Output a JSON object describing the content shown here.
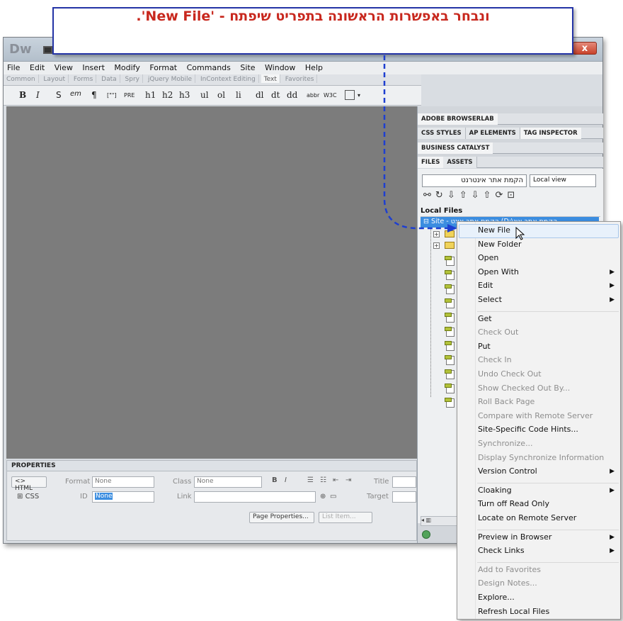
{
  "callout": {
    "text": "ונבחר באפשרות הראשונה בתפריט שיפתח - 'New File'."
  },
  "window": {
    "logo": "Dw",
    "close_label": "x"
  },
  "menubar": [
    "File",
    "Edit",
    "View",
    "Insert",
    "Modify",
    "Format",
    "Commands",
    "Site",
    "Window",
    "Help"
  ],
  "insert_tabs": [
    "Common",
    "Layout",
    "Forms",
    "Data",
    "Spry",
    "jQuery Mobile",
    "InContext Editing",
    "Text",
    "Favorites"
  ],
  "insert_active_tab": "Text",
  "text_toolbar": [
    "B",
    "I",
    "S",
    "em",
    "¶",
    "[\"\"]",
    "PRE",
    "h1",
    "h2",
    "h3",
    "ul",
    "ol",
    "li",
    "dl",
    "dt",
    "dd",
    "abbr",
    "W3C"
  ],
  "properties": {
    "title": "PROPERTIES",
    "html_label": "HTML",
    "css_label": "CSS",
    "format_label": "Format",
    "format_value": "None",
    "id_label": "ID",
    "id_value": "None",
    "class_label": "Class",
    "class_value": "None",
    "link_label": "Link",
    "title_label": "Title",
    "target_label": "Target",
    "page_properties": "Page Properties...",
    "list_item": "List Item..."
  },
  "panels": {
    "browserlab": "ADOBE BROWSERLAB",
    "tabs_row1": [
      "CSS STYLES",
      "AP ELEMENTS",
      "TAG INSPECTOR"
    ],
    "business_catalyst": "BUSINESS CATALYST",
    "tabs_row2": [
      "FILES",
      "ASSETS"
    ],
    "site_select": "הקמת אתר אינטרנט",
    "view_select": "Local view",
    "local_files_label": "Local Files",
    "site_root": "Site - הקמת אתר אינט (D:\\הקמת אתר אינ"
  },
  "context_menu": [
    {
      "label": "New File",
      "enabled": true,
      "highlighted": true
    },
    {
      "label": "New Folder",
      "enabled": true
    },
    {
      "label": "Open",
      "enabled": true
    },
    {
      "label": "Open With",
      "enabled": true,
      "submenu": true
    },
    {
      "label": "Edit",
      "enabled": true,
      "submenu": true
    },
    {
      "label": "Select",
      "enabled": true,
      "submenu": true
    },
    {
      "separator": true
    },
    {
      "label": "Get",
      "enabled": true
    },
    {
      "label": "Check Out",
      "enabled": false
    },
    {
      "label": "Put",
      "enabled": true
    },
    {
      "label": "Check In",
      "enabled": false
    },
    {
      "label": "Undo Check Out",
      "enabled": false
    },
    {
      "label": "Show Checked Out By...",
      "enabled": false
    },
    {
      "label": "Roll Back Page",
      "enabled": false
    },
    {
      "label": "Compare with Remote Server",
      "enabled": false
    },
    {
      "label": "Site-Specific Code Hints...",
      "enabled": true
    },
    {
      "label": "Synchronize...",
      "enabled": false
    },
    {
      "label": "Display Synchronize Information",
      "enabled": false
    },
    {
      "label": "Version Control",
      "enabled": true,
      "submenu": true
    },
    {
      "separator": true
    },
    {
      "label": "Cloaking",
      "enabled": true,
      "submenu": true
    },
    {
      "label": "Turn off Read Only",
      "enabled": true
    },
    {
      "label": "Locate on Remote Server",
      "enabled": true
    },
    {
      "separator": true
    },
    {
      "label": "Preview in Browser",
      "enabled": true,
      "submenu": true
    },
    {
      "label": "Check Links",
      "enabled": true,
      "submenu": true
    },
    {
      "separator": true
    },
    {
      "label": "Add to Favorites",
      "enabled": false
    },
    {
      "label": "Design Notes...",
      "enabled": false
    },
    {
      "label": "Explore...",
      "enabled": true
    },
    {
      "label": "Refresh Local Files",
      "enabled": true
    }
  ]
}
